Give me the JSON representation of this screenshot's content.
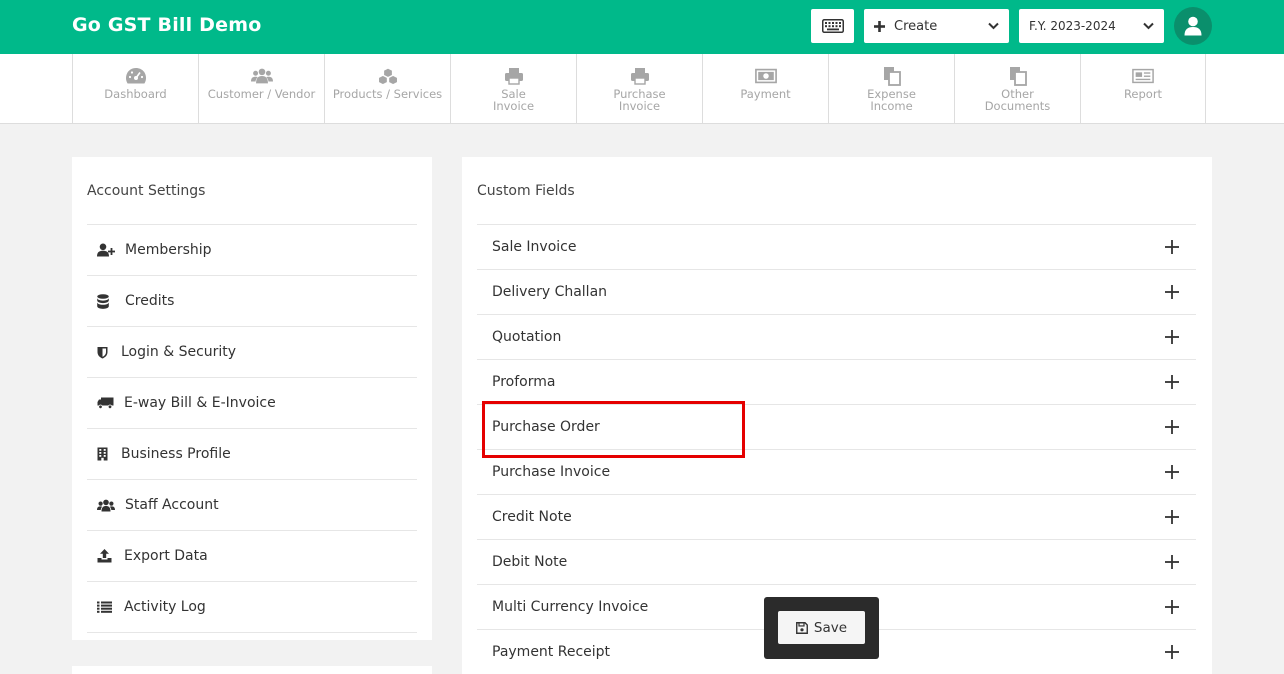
{
  "header": {
    "app_title": "Go GST Bill Demo",
    "create_label": "Create",
    "fy_label": "F.Y. 2023-2024",
    "icons": [
      "keyboard-icon",
      "plus-icon",
      "chevron-down-icon",
      "user-icon"
    ]
  },
  "nav": {
    "items": [
      {
        "label": "Dashboard",
        "icon": "dashboard-icon"
      },
      {
        "label": "Customer / Vendor",
        "icon": "users-icon"
      },
      {
        "label": "Products / Services",
        "icon": "cubes-icon"
      },
      {
        "label": "Sale\nInvoice",
        "icon": "printer-icon"
      },
      {
        "label": "Purchase\nInvoice",
        "icon": "printer-icon"
      },
      {
        "label": "Payment",
        "icon": "money-icon"
      },
      {
        "label": "Expense\nIncome",
        "icon": "copy-icon"
      },
      {
        "label": "Other\nDocuments",
        "icon": "copy-icon"
      },
      {
        "label": "Report",
        "icon": "newspaper-icon"
      }
    ]
  },
  "account_settings": {
    "title": "Account Settings",
    "items": [
      {
        "label": "Membership",
        "icon": "user-plus-icon"
      },
      {
        "label": "Credits",
        "icon": "database-icon"
      },
      {
        "label": "Login & Security",
        "icon": "shield-icon"
      },
      {
        "label": "E-way Bill & E-Invoice",
        "icon": "truck-icon"
      },
      {
        "label": "Business Profile",
        "icon": "building-icon"
      },
      {
        "label": "Staff Account",
        "icon": "users-icon"
      },
      {
        "label": "Export Data",
        "icon": "upload-icon"
      },
      {
        "label": "Activity Log",
        "icon": "list-icon"
      }
    ]
  },
  "custom_fields": {
    "title": "Custom Fields",
    "items": [
      {
        "label": "Sale Invoice"
      },
      {
        "label": "Delivery Challan"
      },
      {
        "label": "Quotation"
      },
      {
        "label": "Proforma"
      },
      {
        "label": "Purchase Order"
      },
      {
        "label": "Purchase Invoice"
      },
      {
        "label": "Credit Note"
      },
      {
        "label": "Debit Note"
      },
      {
        "label": "Multi Currency Invoice"
      },
      {
        "label": "Payment Receipt"
      }
    ]
  },
  "save": {
    "label": "Save",
    "icon": "floppy-disk-icon"
  },
  "colors": {
    "brand": "#00b98a",
    "highlight": "#e50000",
    "save_bar": "#2b2b2b"
  }
}
